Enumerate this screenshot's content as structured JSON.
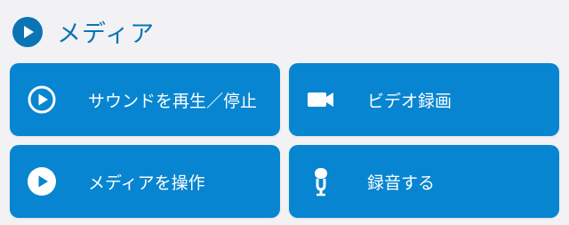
{
  "header": {
    "icon": "play-circle-icon",
    "title": "メディア"
  },
  "tiles": [
    {
      "icon": "play-circle-outline-icon",
      "label": "サウンドを再生／停止"
    },
    {
      "icon": "video-camera-icon",
      "label": "ビデオ録画"
    },
    {
      "icon": "play-circle-icon",
      "label": "メディアを操作"
    },
    {
      "icon": "microphone-icon",
      "label": "録音する"
    }
  ],
  "colors": {
    "accent": "#0a74b5",
    "tile_background": "#0785d1",
    "page_background": "#f2f2f4"
  }
}
